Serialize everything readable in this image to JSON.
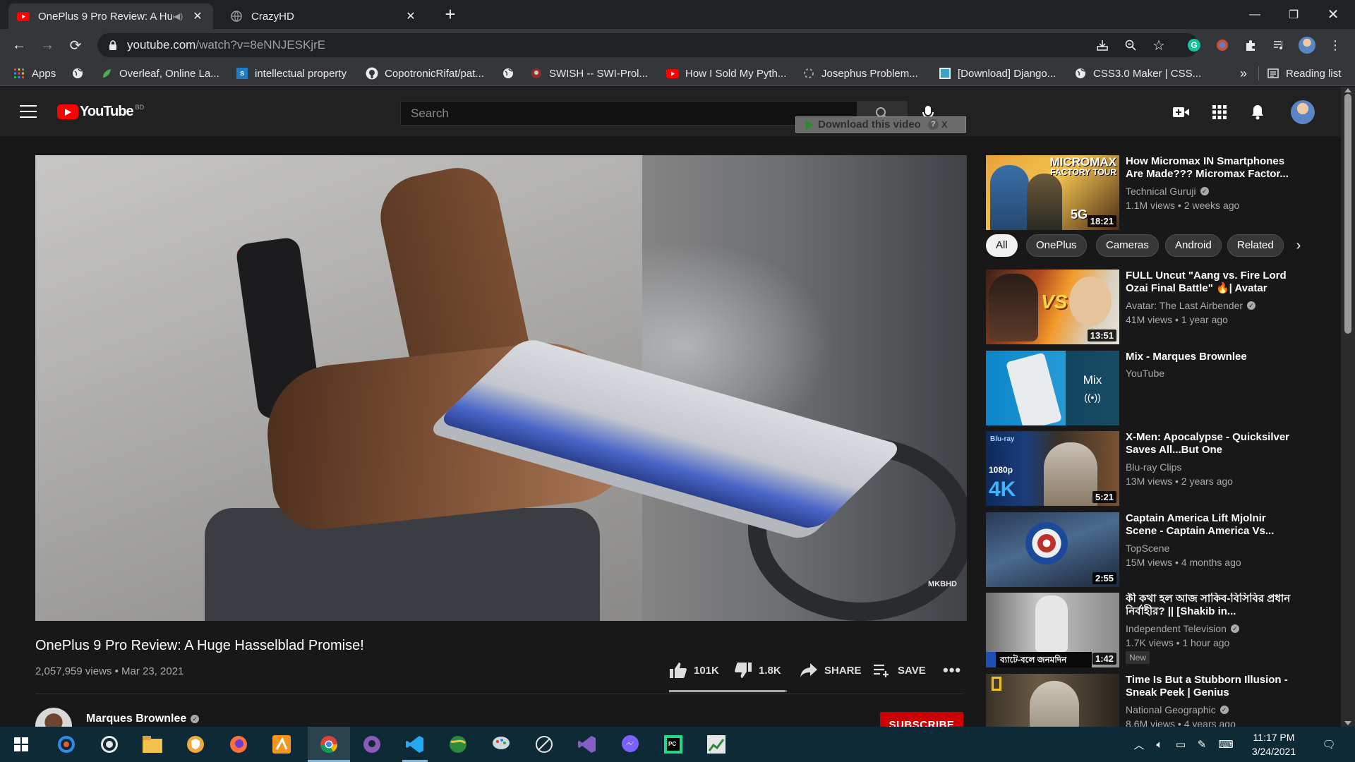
{
  "browser": {
    "tabs": [
      {
        "title": "OnePlus 9 Pro Review: A Hug",
        "icon": "youtube-icon",
        "audio": true,
        "active": true
      },
      {
        "title": "CrazyHD",
        "icon": "globe-icon",
        "active": false
      }
    ],
    "address": {
      "host": "youtube.com",
      "path": "/watch?v=8eNNJESKjrE"
    },
    "bookmarks": [
      {
        "label": "Apps",
        "icon": "apps-grid-icon"
      },
      {
        "label": "",
        "icon": "globe-icon"
      },
      {
        "label": "Overleaf, Online La...",
        "icon": "overleaf-leaf-icon"
      },
      {
        "label": "intellectual property",
        "icon": "scribd-icon"
      },
      {
        "label": "CopotronicRifat/pat...",
        "icon": "github-icon"
      },
      {
        "label": "",
        "icon": "globe-icon"
      },
      {
        "label": "SWISH -- SWI-Prol...",
        "icon": "swi-prolog-icon"
      },
      {
        "label": "How I Sold My Pyth...",
        "icon": "youtube-icon"
      },
      {
        "label": "Josephus Problem...",
        "icon": "loading-icon"
      },
      {
        "label": "[Download] Django...",
        "icon": "image-icon"
      },
      {
        "label": "CSS3.0 Maker | CSS...",
        "icon": "globe-icon"
      }
    ],
    "bookmarks_overflow": "»",
    "reading_list": "Reading list"
  },
  "youtube": {
    "logo_text": "YouTube",
    "country_code": "BD",
    "search_placeholder": "Search",
    "download_overlay": {
      "label": "Download this video",
      "help": "?",
      "close": "X"
    }
  },
  "video": {
    "watermark": "MKBHD",
    "title": "OnePlus 9 Pro Review: A Huge Hasselblad Promise!",
    "views": "2,057,959 views",
    "date": "Mar 23, 2021",
    "likes": "101K",
    "dislikes": "1.8K",
    "like_ratio": 0.98,
    "share": "SHARE",
    "save": "SAVE",
    "channel": "Marques Brownlee",
    "subscribe": "SUBSCRIBE"
  },
  "sidebar": {
    "chips": [
      "All",
      "OnePlus",
      "Cameras",
      "Android",
      "Related"
    ],
    "top": {
      "title": "How Micromax IN Smartphones Are Made??? Micromax Factor...",
      "channel": "Technical Guruji",
      "verified": true,
      "meta": "1.1M views • 2 weeks ago",
      "duration": "18:21",
      "thumb_text_1": "MICROMAX",
      "thumb_text_2": "FACTORY TOUR",
      "thumb_text_3": "5G"
    },
    "items": [
      {
        "title": "FULL Uncut \"Aang vs. Fire Lord Ozai Final Battle\" 🔥| Avatar",
        "channel": "Avatar: The Last Airbender",
        "verified": true,
        "meta": "41M views • 1 year ago",
        "duration": "13:51",
        "thumb_text": "VS"
      },
      {
        "title": "Mix - Marques Brownlee",
        "channel": "YouTube",
        "verified": false,
        "meta": "",
        "mix_label": "Mix",
        "mix_icon": "((•))"
      },
      {
        "title": "X-Men: Apocalypse - Quicksilver Saves All...But One",
        "channel": "Blu-ray Clips",
        "verified": false,
        "meta": "13M views • 2 years ago",
        "duration": "5:21",
        "thumb_text": "4K",
        "thumb_text_small": "1080p"
      },
      {
        "title": "Captain America Lift Mjolnir Scene - Captain America Vs...",
        "channel": "TopScene",
        "verified": false,
        "meta": "15M views • 4 months ago",
        "duration": "2:55"
      },
      {
        "title": "কী কথা হল আজ সাকিব-বিসিবির প্রধান নির্বাহীর? || [Shakib in...",
        "channel": "Independent Television",
        "verified": true,
        "meta": "1.7K views • 1 hour ago",
        "duration": "1:42",
        "badge": "New",
        "thumb_text": "ব্যাটে-বলে জনমদিন"
      },
      {
        "title": "Time Is But a Stubborn Illusion - Sneak Peek | Genius",
        "channel": "National Geographic",
        "verified": true,
        "meta": "8.6M views • 4 years ago"
      }
    ]
  },
  "taskbar": {
    "time": "11:17 PM",
    "date": "3/24/2021"
  }
}
